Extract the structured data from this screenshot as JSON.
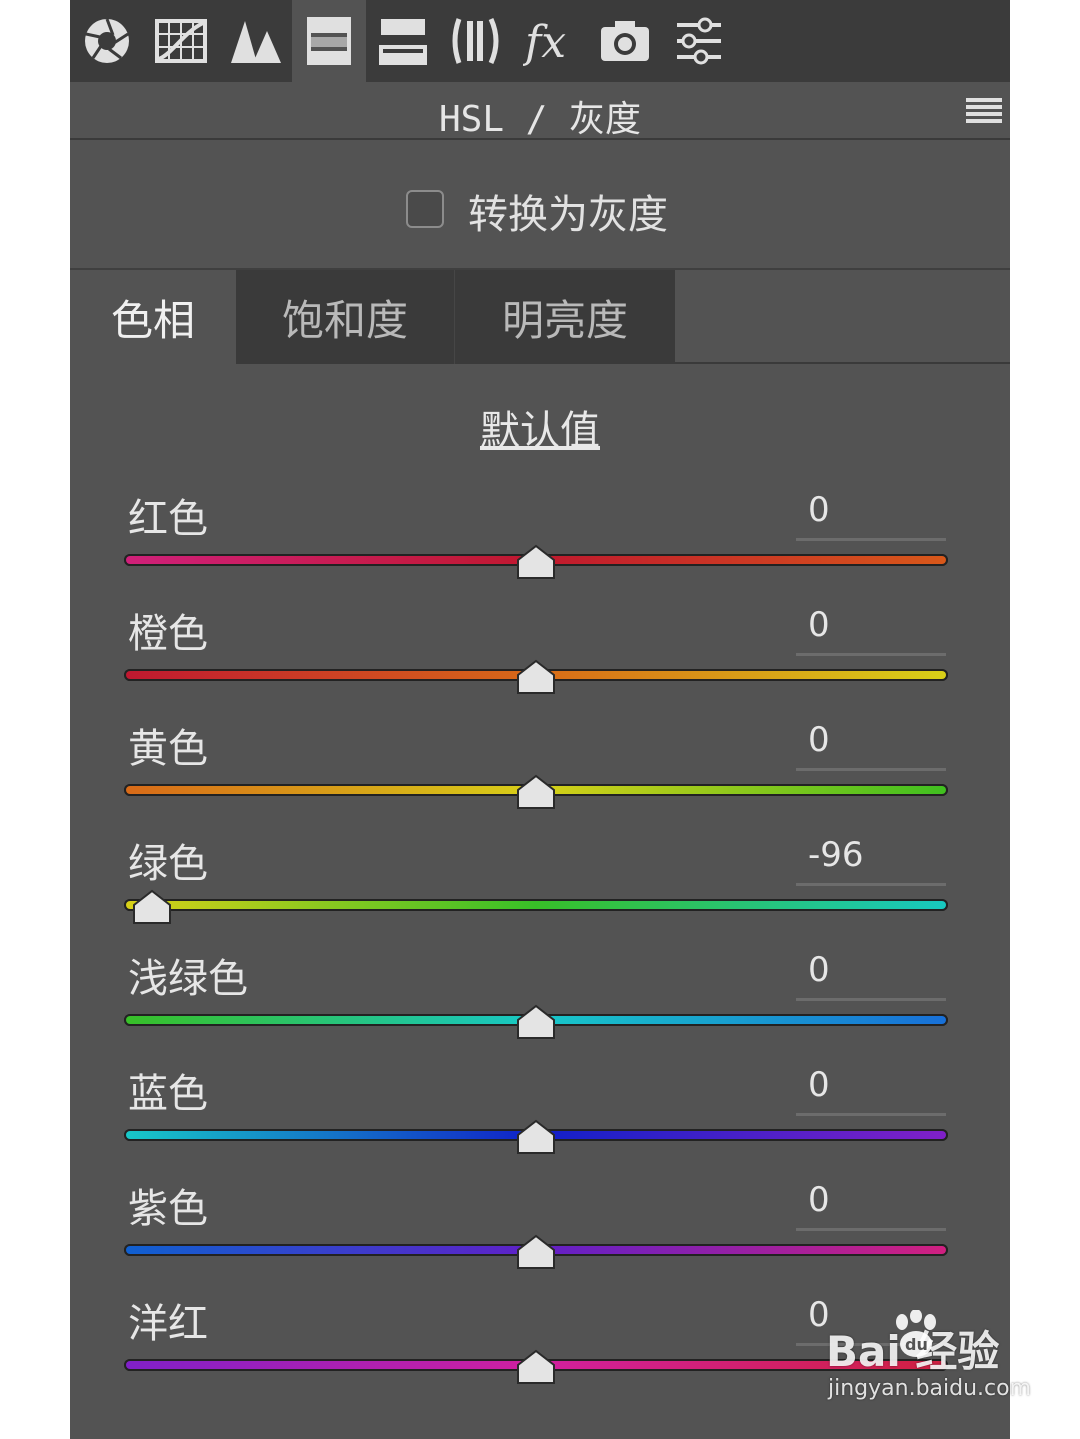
{
  "toolbar": {
    "tools": [
      {
        "name": "basic-aperture-icon"
      },
      {
        "name": "tone-curve-icon"
      },
      {
        "name": "detail-icon"
      },
      {
        "name": "hsl-grayscale-icon",
        "active": true
      },
      {
        "name": "split-toning-icon"
      },
      {
        "name": "lens-corrections-icon"
      },
      {
        "name": "effects-fx-icon"
      },
      {
        "name": "camera-calibration-icon"
      },
      {
        "name": "presets-sliders-icon"
      }
    ]
  },
  "panel": {
    "title": "HSL / 灰度",
    "menu_icon": "menu-icon"
  },
  "grayscale": {
    "label": "转换为灰度",
    "checked": false
  },
  "tabs": [
    {
      "label": "色相",
      "active": true
    },
    {
      "label": "饱和度",
      "active": false
    },
    {
      "label": "明亮度",
      "active": false
    }
  ],
  "default_link": "默认值",
  "sliders": [
    {
      "label": "红色",
      "value": "0",
      "pos": 0,
      "colors": [
        "#d0207a",
        "#c0182e",
        "#d8581a"
      ]
    },
    {
      "label": "橙色",
      "value": "0",
      "pos": 0,
      "colors": [
        "#c01830",
        "#d86a18",
        "#d8d018"
      ]
    },
    {
      "label": "黄色",
      "value": "0",
      "pos": 0,
      "colors": [
        "#d86a18",
        "#d8d018",
        "#40c020"
      ]
    },
    {
      "label": "绿色",
      "value": "-96",
      "pos": -96,
      "colors": [
        "#d8d018",
        "#38c028",
        "#18c8c0"
      ]
    },
    {
      "label": "浅绿色",
      "value": "0",
      "pos": 0,
      "colors": [
        "#38c028",
        "#18c8c8",
        "#1870d8"
      ]
    },
    {
      "label": "蓝色",
      "value": "0",
      "pos": 0,
      "colors": [
        "#18c8c8",
        "#1020c8",
        "#8020c8"
      ]
    },
    {
      "label": "紫色",
      "value": "0",
      "pos": 0,
      "colors": [
        "#1060d0",
        "#6020c8",
        "#d02080"
      ]
    },
    {
      "label": "洋红",
      "value": "0",
      "pos": 0,
      "colors": [
        "#8020c8",
        "#d020a0",
        "#d02040"
      ]
    }
  ],
  "watermark": {
    "brand": "Bai  经验",
    "url": "jingyan.baidu.com"
  }
}
